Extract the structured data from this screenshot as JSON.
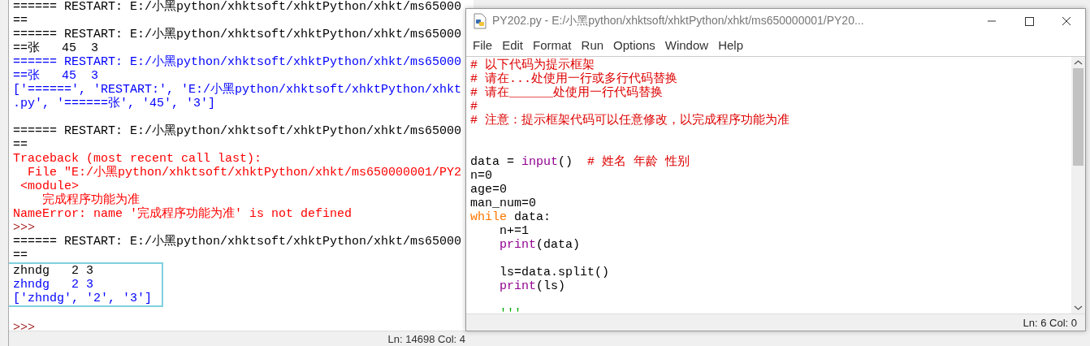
{
  "shell": {
    "lines": [
      {
        "kind": "stdout",
        "text": "====== RESTART: E:/小黑python/xhktsoft/xhktPython/xhkt/ms65000",
        "framed": false
      },
      {
        "kind": "stdout",
        "text": "==",
        "framed": false
      },
      {
        "kind": "stdout",
        "text": "====== RESTART: E:/小黑python/xhktsoft/xhktPython/xhkt/ms65000",
        "framed": false
      },
      {
        "kind": "stdout",
        "text": "==张   45  3",
        "framed": false
      },
      {
        "kind": "output",
        "text": "====== RESTART: E:/小黑python/xhktsoft/xhktPython/xhkt/ms65000",
        "framed": false
      },
      {
        "kind": "output",
        "text": "==张   45  3",
        "framed": false
      },
      {
        "kind": "output",
        "text": "['======', 'RESTART:', 'E:/小黑python/xhktsoft/xhktPython/xhkt",
        "framed": false
      },
      {
        "kind": "output",
        "text": ".py', '======张', '45', '3']",
        "framed": false
      },
      {
        "kind": "blank",
        "framed": false
      },
      {
        "kind": "stdout",
        "text": "====== RESTART: E:/小黑python/xhktsoft/xhktPython/xhkt/ms65000",
        "framed": false
      },
      {
        "kind": "stdout",
        "text": "==",
        "framed": false
      },
      {
        "kind": "error",
        "text": "Traceback (most recent call last):",
        "framed": false
      },
      {
        "kind": "error",
        "text": "  File \"E:/小黑python/xhktsoft/xhktPython/xhkt/ms650000001/PY2",
        "framed": false
      },
      {
        "kind": "error",
        "text": " <module>",
        "framed": false
      },
      {
        "kind": "error",
        "text": "    完成程序功能为准",
        "framed": false
      },
      {
        "kind": "error",
        "text": "NameError: name '完成程序功能为准' is not defined",
        "framed": false
      },
      {
        "kind": "prompt",
        "text": ">>>",
        "framed": false
      },
      {
        "kind": "stdout",
        "text": "====== RESTART: E:/小黑python/xhktsoft/xhktPython/xhkt/ms65000",
        "framed": false
      },
      {
        "kind": "stdout",
        "text": "==",
        "framed": false
      },
      {
        "kind": "stdout",
        "text": "zhndg   2 3",
        "framed": true
      },
      {
        "kind": "output",
        "text": "zhndg   2 3",
        "framed": true
      },
      {
        "kind": "output",
        "text": "['zhndg', '2', '3']",
        "framed": true
      },
      {
        "kind": "blank",
        "framed": false
      },
      {
        "kind": "prompt",
        "text": ">>>",
        "framed": false
      }
    ],
    "status": "Ln: 14698  Col: 4"
  },
  "editor": {
    "title": "PY202.py - E:/小黑python/xhktsoft/xhktPython/xhkt/ms650000001/PY20...",
    "menu": [
      "File",
      "Edit",
      "Format",
      "Run",
      "Options",
      "Window",
      "Help"
    ],
    "lines": [
      {
        "segments": [
          {
            "kind": "comment",
            "text": "# 以下代码为提示框架"
          }
        ]
      },
      {
        "segments": [
          {
            "kind": "comment",
            "text": "# 请在...处使用一行或多行代码替换"
          }
        ]
      },
      {
        "segments": [
          {
            "kind": "comment",
            "text": "# 请在______处使用一行代码替换"
          }
        ]
      },
      {
        "segments": [
          {
            "kind": "comment",
            "text": "#"
          }
        ]
      },
      {
        "segments": [
          {
            "kind": "comment",
            "text": "# 注意：提示框架代码可以任意修改，以完成程序功能为准"
          }
        ]
      },
      {
        "kind": "blank"
      },
      {
        "kind": "blank"
      },
      {
        "segments": [
          {
            "kind": "plain",
            "text": "data = "
          },
          {
            "kind": "builtin",
            "text": "input"
          },
          {
            "kind": "plain",
            "text": "()  "
          },
          {
            "kind": "comment",
            "text": "# 姓名 年龄 性别"
          }
        ]
      },
      {
        "segments": [
          {
            "kind": "plain",
            "text": "n=0"
          }
        ]
      },
      {
        "segments": [
          {
            "kind": "plain",
            "text": "age=0"
          }
        ]
      },
      {
        "segments": [
          {
            "kind": "plain",
            "text": "man_num=0"
          }
        ]
      },
      {
        "segments": [
          {
            "kind": "keyword",
            "text": "while"
          },
          {
            "kind": "plain",
            "text": " data:"
          }
        ]
      },
      {
        "indented": true,
        "segments": [
          {
            "kind": "plain",
            "text": "n+=1"
          }
        ]
      },
      {
        "indented": true,
        "segments": [
          {
            "kind": "builtin",
            "text": "print"
          },
          {
            "kind": "plain",
            "text": "(data)"
          }
        ]
      },
      {
        "kind": "blank"
      },
      {
        "indented": true,
        "segments": [
          {
            "kind": "plain",
            "text": "ls=data.split()"
          }
        ]
      },
      {
        "indented": true,
        "segments": [
          {
            "kind": "builtin",
            "text": "print"
          },
          {
            "kind": "plain",
            "text": "(ls)"
          }
        ]
      },
      {
        "kind": "blank"
      },
      {
        "indented": true,
        "segments": [
          {
            "kind": "string",
            "text": "'''"
          }
        ]
      }
    ],
    "status": "Ln: 6  Col: 0"
  }
}
